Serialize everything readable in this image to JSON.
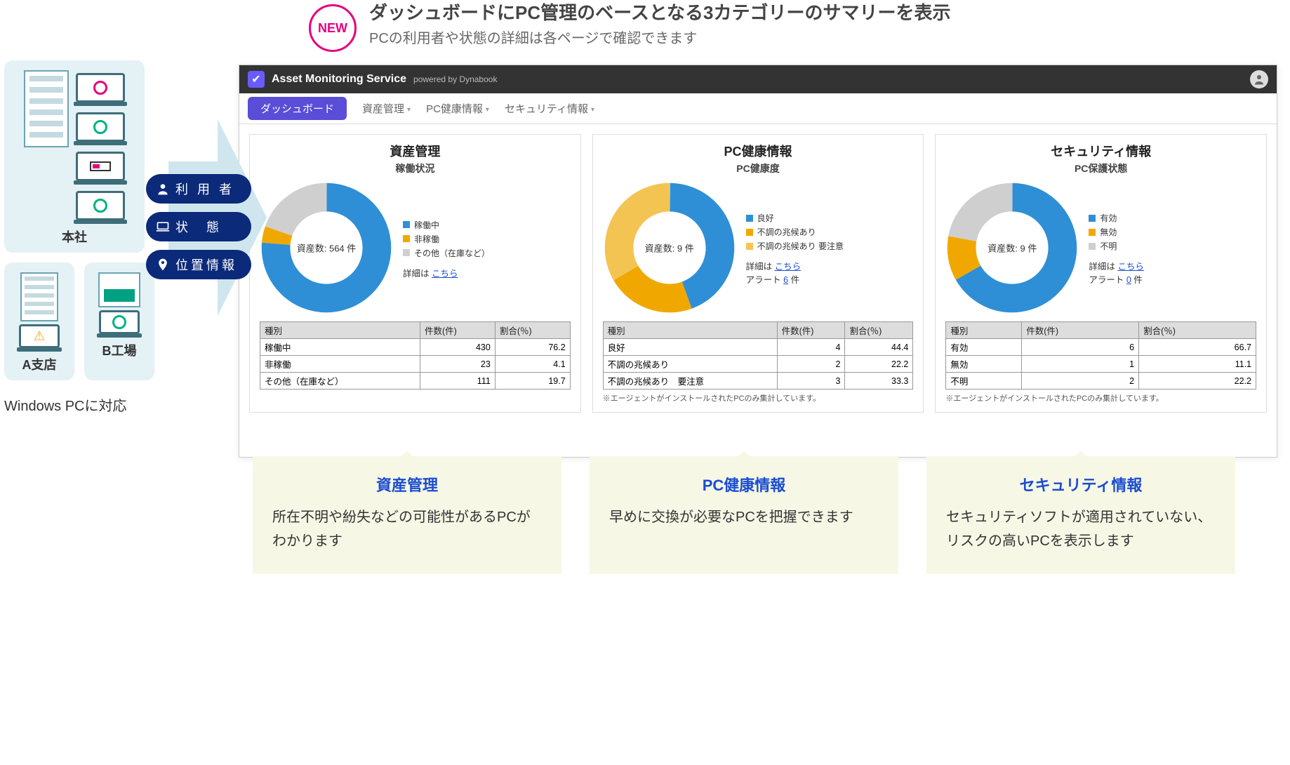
{
  "headline": {
    "badge": "NEW",
    "title": "ダッシュボードにPC管理のベースとなる3カテゴリーのサマリーを表示",
    "subtitle": "PCの利用者や状態の詳細は各ページで確認できます"
  },
  "left_diagram": {
    "hq_label": "本社",
    "branch_a_label": "A支店",
    "factory_b_label": "B工場",
    "footer": "Windows PCに対応"
  },
  "pills": {
    "user": "利 用 者",
    "state": "状　態",
    "location": "位置情報"
  },
  "app": {
    "name": "Asset Monitoring Service",
    "powered": "powered by Dynabook",
    "menu": {
      "dashboard": "ダッシュボード",
      "asset": "資産管理",
      "health": "PC健康情報",
      "security": "セキュリティ情報"
    }
  },
  "cards": {
    "asset": {
      "title": "資産管理",
      "subtitle": "稼働状況",
      "center": "資産数: 564 件",
      "legend": [
        "稼働中",
        "非稼働",
        "その他（在庫など）"
      ],
      "detail_prefix": "詳細は ",
      "detail_link": "こちら",
      "table_headers": [
        "種別",
        "件数(件)",
        "割合(％)"
      ],
      "rows": [
        {
          "label": "稼働中",
          "count": 430,
          "pct": 76.2
        },
        {
          "label": "非稼働",
          "count": 23,
          "pct": 4.1
        },
        {
          "label": "その他（在庫など）",
          "count": 111,
          "pct": 19.7
        }
      ]
    },
    "health": {
      "title": "PC健康情報",
      "subtitle": "PC健康度",
      "center": "資産数: 9 件",
      "legend": [
        "良好",
        "不調の兆候あり",
        "不調の兆候あり 要注意"
      ],
      "detail_prefix": "詳細は ",
      "detail_link": "こちら",
      "alert_prefix": "アラート ",
      "alert_count": "6",
      "alert_suffix": " 件",
      "table_headers": [
        "種別",
        "件数(件)",
        "割合(％)"
      ],
      "rows": [
        {
          "label": "良好",
          "count": 4,
          "pct": 44.4
        },
        {
          "label": "不調の兆候あり",
          "count": 2,
          "pct": 22.2
        },
        {
          "label": "不調の兆候あり　要注意",
          "count": 3,
          "pct": 33.3
        }
      ],
      "note": "※エージェントがインストールされたPCのみ集計しています。"
    },
    "security": {
      "title": "セキュリティ情報",
      "subtitle": "PC保護状態",
      "center": "資産数: 9 件",
      "legend": [
        "有効",
        "無効",
        "不明"
      ],
      "detail_prefix": "詳細は ",
      "detail_link": "こちら",
      "alert_prefix": "アラート ",
      "alert_count": "0",
      "alert_suffix": " 件",
      "table_headers": [
        "種別",
        "件数(件)",
        "割合(％)"
      ],
      "rows": [
        {
          "label": "有効",
          "count": 6,
          "pct": 66.7
        },
        {
          "label": "無効",
          "count": 1,
          "pct": 11.1
        },
        {
          "label": "不明",
          "count": 2,
          "pct": 22.2
        }
      ],
      "note": "※エージェントがインストールされたPCのみ集計しています。"
    }
  },
  "callouts": {
    "asset": {
      "title": "資産管理",
      "body": "所在不明や紛失などの可能性があるPCがわかります"
    },
    "health": {
      "title": "PC健康情報",
      "body": "早めに交換が必要なPCを把握できます"
    },
    "security": {
      "title": "セキュリティ情報",
      "body": "セキュリティソフトが適用されていない、リスクの高いPCを表示します"
    }
  },
  "chart_data": [
    {
      "type": "pie",
      "title": "資産管理 稼働状況",
      "categories": [
        "稼働中",
        "非稼働",
        "その他（在庫など）"
      ],
      "values": [
        430,
        23,
        111
      ],
      "percentages": [
        76.2,
        4.1,
        19.7
      ],
      "colors": [
        "#2f8fd6",
        "#f0a800",
        "#cfcfcf"
      ],
      "total_label": "資産数: 564 件"
    },
    {
      "type": "pie",
      "title": "PC健康情報 PC健康度",
      "categories": [
        "良好",
        "不調の兆候あり",
        "不調の兆候あり 要注意"
      ],
      "values": [
        4,
        2,
        3
      ],
      "percentages": [
        44.4,
        22.2,
        33.3
      ],
      "colors": [
        "#2f8fd6",
        "#f0a800",
        "#f4c453"
      ],
      "total_label": "資産数: 9 件"
    },
    {
      "type": "pie",
      "title": "セキュリティ情報 PC保護状態",
      "categories": [
        "有効",
        "無効",
        "不明"
      ],
      "values": [
        6,
        1,
        2
      ],
      "percentages": [
        66.7,
        11.1,
        22.2
      ],
      "colors": [
        "#2f8fd6",
        "#f0a800",
        "#cfcfcf"
      ],
      "total_label": "資産数: 9 件"
    }
  ]
}
